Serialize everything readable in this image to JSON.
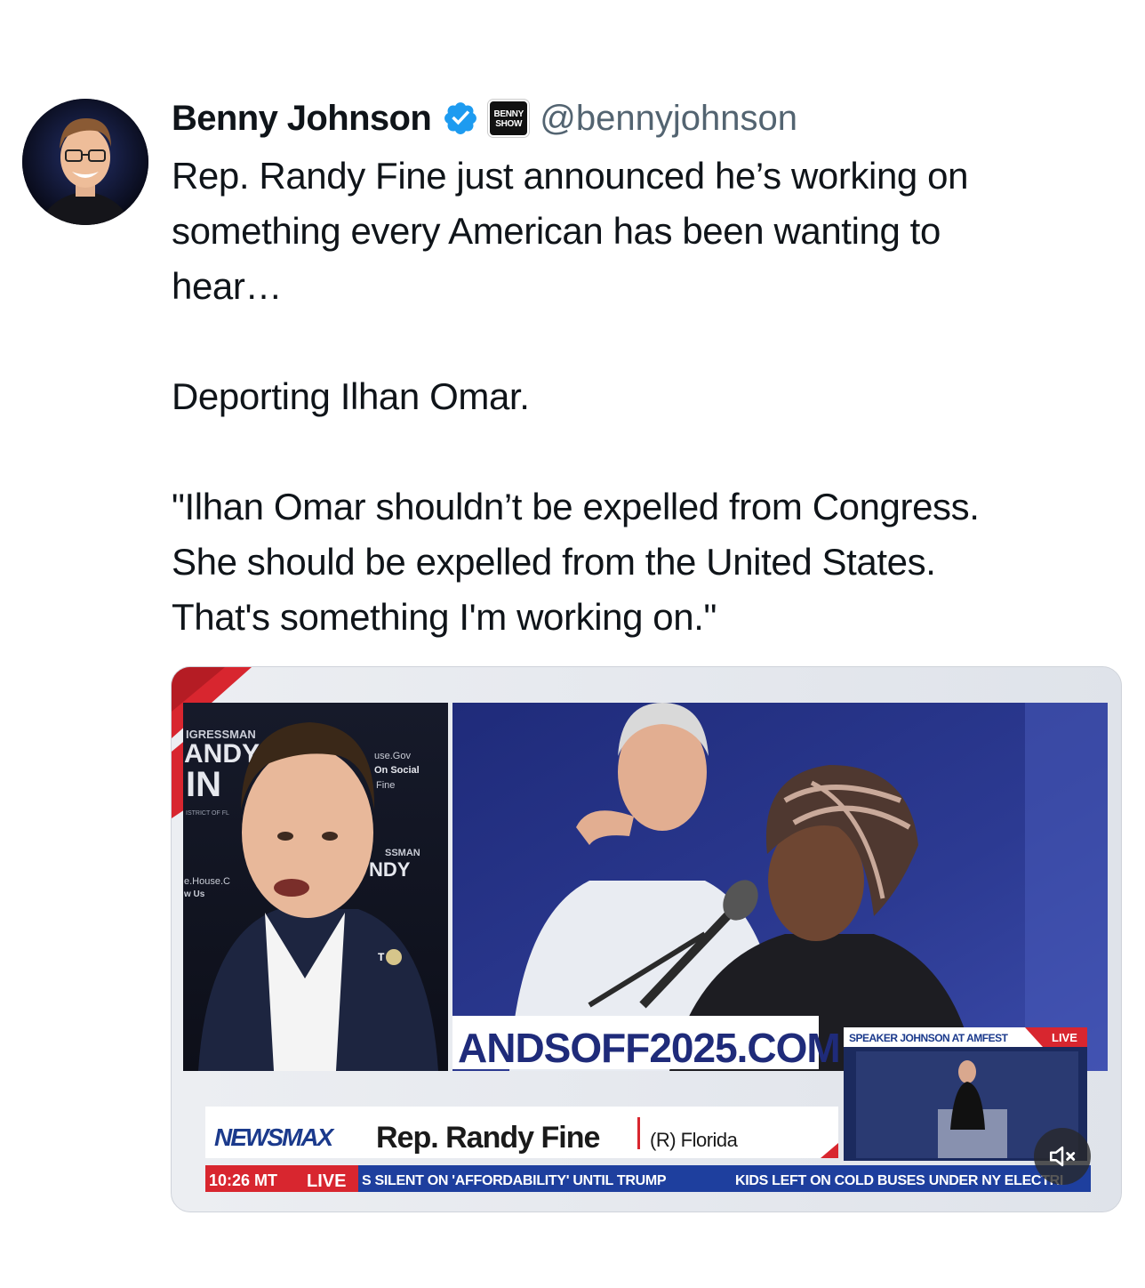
{
  "author": {
    "name": "Benny Johnson",
    "handle": "@bennyjohnson",
    "affiliation_badge_text": [
      "BENNY",
      "SHOW"
    ]
  },
  "tweet": {
    "lines": [
      "Rep. Randy Fine just announced he’s working on",
      "something every American has been wanting to",
      "hear…",
      "",
      "Deporting Ilhan Omar.",
      "",
      "\"Ilhan Omar shouldn’t be expelled from Congress.",
      "She should be expelled from the United States.",
      "That's something I'm working on.\""
    ]
  },
  "video": {
    "backdrop_left": {
      "top_label": "IGRESSMAN",
      "big1": "ANDY",
      "big2": "IN",
      "small_right1": "use.Gov",
      "small_right2": "On Social",
      "small_right3": "Fine",
      "small_left1": "e.House.C",
      "small_left2": "w Us",
      "right_label": "SSMAN",
      "right_big": "NDY",
      "district": "ISTRICT OF FL"
    },
    "banner_text": "ANDSOFF2025.COM",
    "pip": {
      "title": "SPEAKER JOHNSON AT AMFEST",
      "live": "LIVE"
    },
    "lower_third": {
      "network": "NEWSMAX",
      "name": "Rep. Randy Fine",
      "party_state": "(R) Florida"
    },
    "ticker": {
      "time": "10:26 MT",
      "live": "LIVE",
      "item1": "S SILENT ON 'AFFORDABILITY' UNTIL TRUMP",
      "item2": "KIDS LEFT ON COLD BUSES UNDER NY ELECTRI"
    },
    "muted": true
  },
  "colors": {
    "verified_blue": "#1d9bf0",
    "handle_gray": "#536471",
    "newsmax_blue": "#1b3a8c",
    "ticker_blue": "#1e3f9e",
    "accent_red": "#d8262f"
  }
}
